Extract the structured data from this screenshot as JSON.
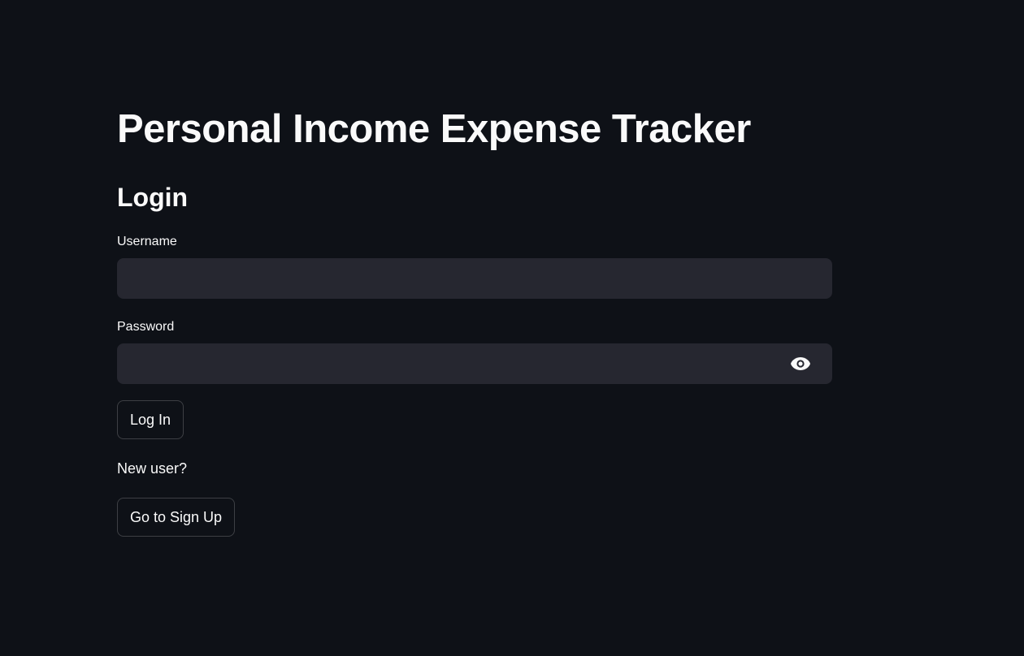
{
  "header": {
    "title": "Personal Income Expense Tracker"
  },
  "login": {
    "heading": "Login",
    "username_label": "Username",
    "username_value": "",
    "password_label": "Password",
    "password_value": "",
    "password_toggle_icon": "eye-icon",
    "login_button_label": "Log In",
    "new_user_text": "New user?",
    "signup_button_label": "Go to Sign Up"
  },
  "colors": {
    "background": "#0e1117",
    "input_background": "#262730",
    "text": "#fafafa"
  }
}
